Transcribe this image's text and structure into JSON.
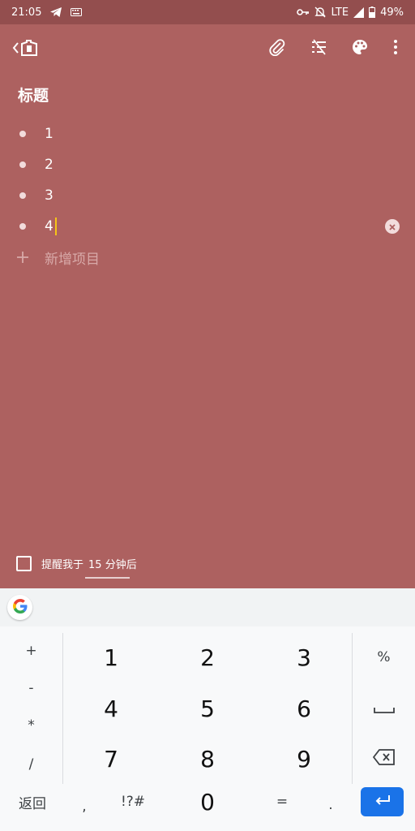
{
  "status_bar": {
    "time": "21:05",
    "network": "LTE",
    "battery": "49%"
  },
  "note": {
    "title": "标题",
    "items": [
      "1",
      "2",
      "3",
      "4"
    ],
    "add_item_placeholder": "新增项目"
  },
  "reminder": {
    "label": "提醒我于",
    "time": "15 分钟后",
    "checked": false
  },
  "keyboard": {
    "left_column": [
      "+",
      "-",
      "*",
      "/"
    ],
    "digits_row1": [
      "1",
      "2",
      "3"
    ],
    "digits_row2": [
      "4",
      "5",
      "6"
    ],
    "digits_row3": [
      "7",
      "8",
      "9"
    ],
    "percent": "%",
    "bottom": {
      "back": "返回",
      "comma": ",",
      "symbols": "!?#",
      "zero": "0",
      "equals": "=",
      "period": "."
    }
  },
  "colors": {
    "note_background": "#AD6160",
    "status_bar": "#934E4E",
    "cursor": "#F5C518",
    "enter_key": "#1A73E8"
  },
  "icons": [
    "telegram-icon",
    "keyboard-icon",
    "key-icon",
    "notifications-off-icon",
    "signal-icon",
    "battery-icon",
    "back-arrow-icon",
    "keep-logo-icon",
    "attach-icon",
    "hide-checkboxes-icon",
    "palette-icon",
    "more-vert-icon",
    "clear-icon",
    "add-icon",
    "google-icon",
    "space-icon",
    "backspace-icon",
    "enter-icon"
  ]
}
